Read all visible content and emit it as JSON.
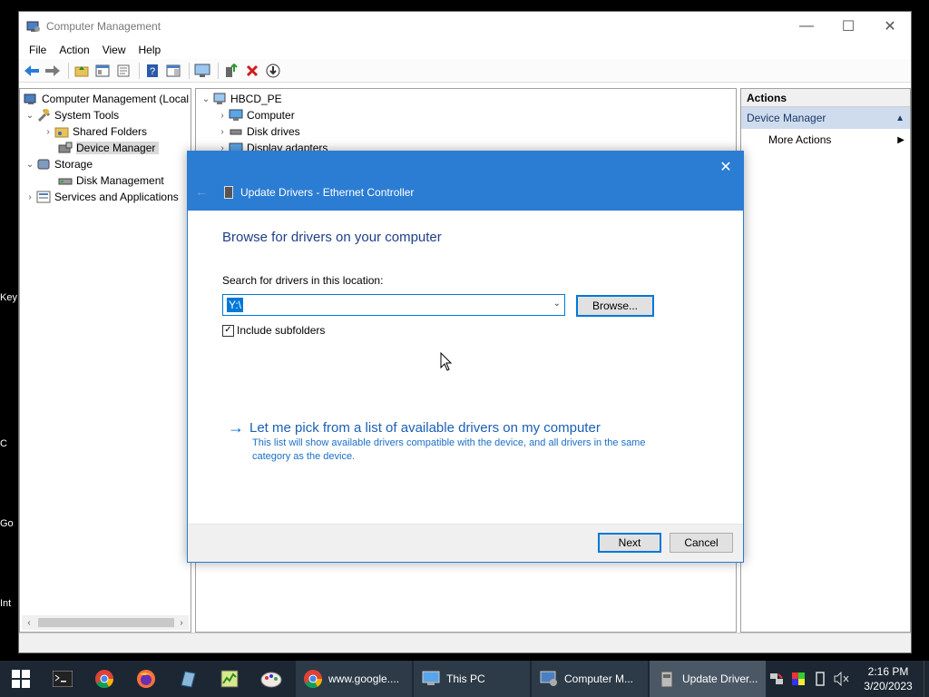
{
  "desktop_labels": [
    "Key",
    "C",
    "Go",
    "Int"
  ],
  "window": {
    "title": "Computer Management",
    "controls": {
      "minimize": "—",
      "maximize": "☐",
      "close": "✕"
    }
  },
  "menu": [
    "File",
    "Action",
    "View",
    "Help"
  ],
  "tree": {
    "root": "Computer Management (Local",
    "system_tools": "System Tools",
    "shared_folders": "Shared Folders",
    "device_manager": "Device Manager",
    "storage": "Storage",
    "disk_management": "Disk Management",
    "services": "Services and Applications"
  },
  "devices": {
    "root": "HBCD_PE",
    "items": [
      "Computer",
      "Disk drives",
      "Display adapters"
    ]
  },
  "actions": {
    "header": "Actions",
    "section": "Device Manager",
    "more": "More Actions"
  },
  "dialog": {
    "title": "Update Drivers - Ethernet Controller",
    "heading": "Browse for drivers on your computer",
    "search_label": "Search for drivers in this location:",
    "path_value": "Y:\\",
    "browse_label": "Browse...",
    "include_subfolders": "Include subfolders",
    "include_checked": true,
    "pick_link": "Let me pick from a list of available drivers on my computer",
    "pick_desc": "This list will show available drivers compatible with the device, and all drivers in the same category as the device.",
    "next_label": "Next",
    "cancel_label": "Cancel"
  },
  "taskbar": {
    "apps": [
      {
        "label": "www.google....",
        "icon": "chrome-icon"
      },
      {
        "label": "This PC",
        "icon": "this-pc-icon"
      },
      {
        "label": "Computer M...",
        "icon": "computer-management-icon"
      },
      {
        "label": "Update Driver...",
        "icon": "update-driver-icon"
      }
    ],
    "time": "2:16 PM",
    "date": "3/20/2023"
  },
  "colors": {
    "dialog_accent": "#2b7cd3",
    "link": "#1a5fb4",
    "taskbar": "#1c2733"
  }
}
